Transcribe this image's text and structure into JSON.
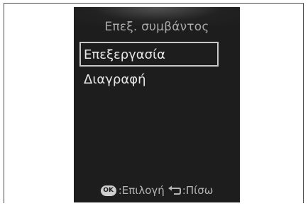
{
  "screen": {
    "title": "Επεξ. συμβάντος",
    "menu": [
      {
        "label": "Επεξεργασία",
        "selected": true
      },
      {
        "label": "Διαγραφή",
        "selected": false
      }
    ],
    "footer": {
      "ok_icon": "OK",
      "ok_label": ":Επιλογή",
      "back_icon": "back-arrow-icon",
      "back_label": ":Πίσω"
    }
  },
  "colors": {
    "background": "#1d1d1d",
    "text": "#e8e8e8",
    "selection_border": "#c8c8c8",
    "title": "#a9a9a9"
  }
}
